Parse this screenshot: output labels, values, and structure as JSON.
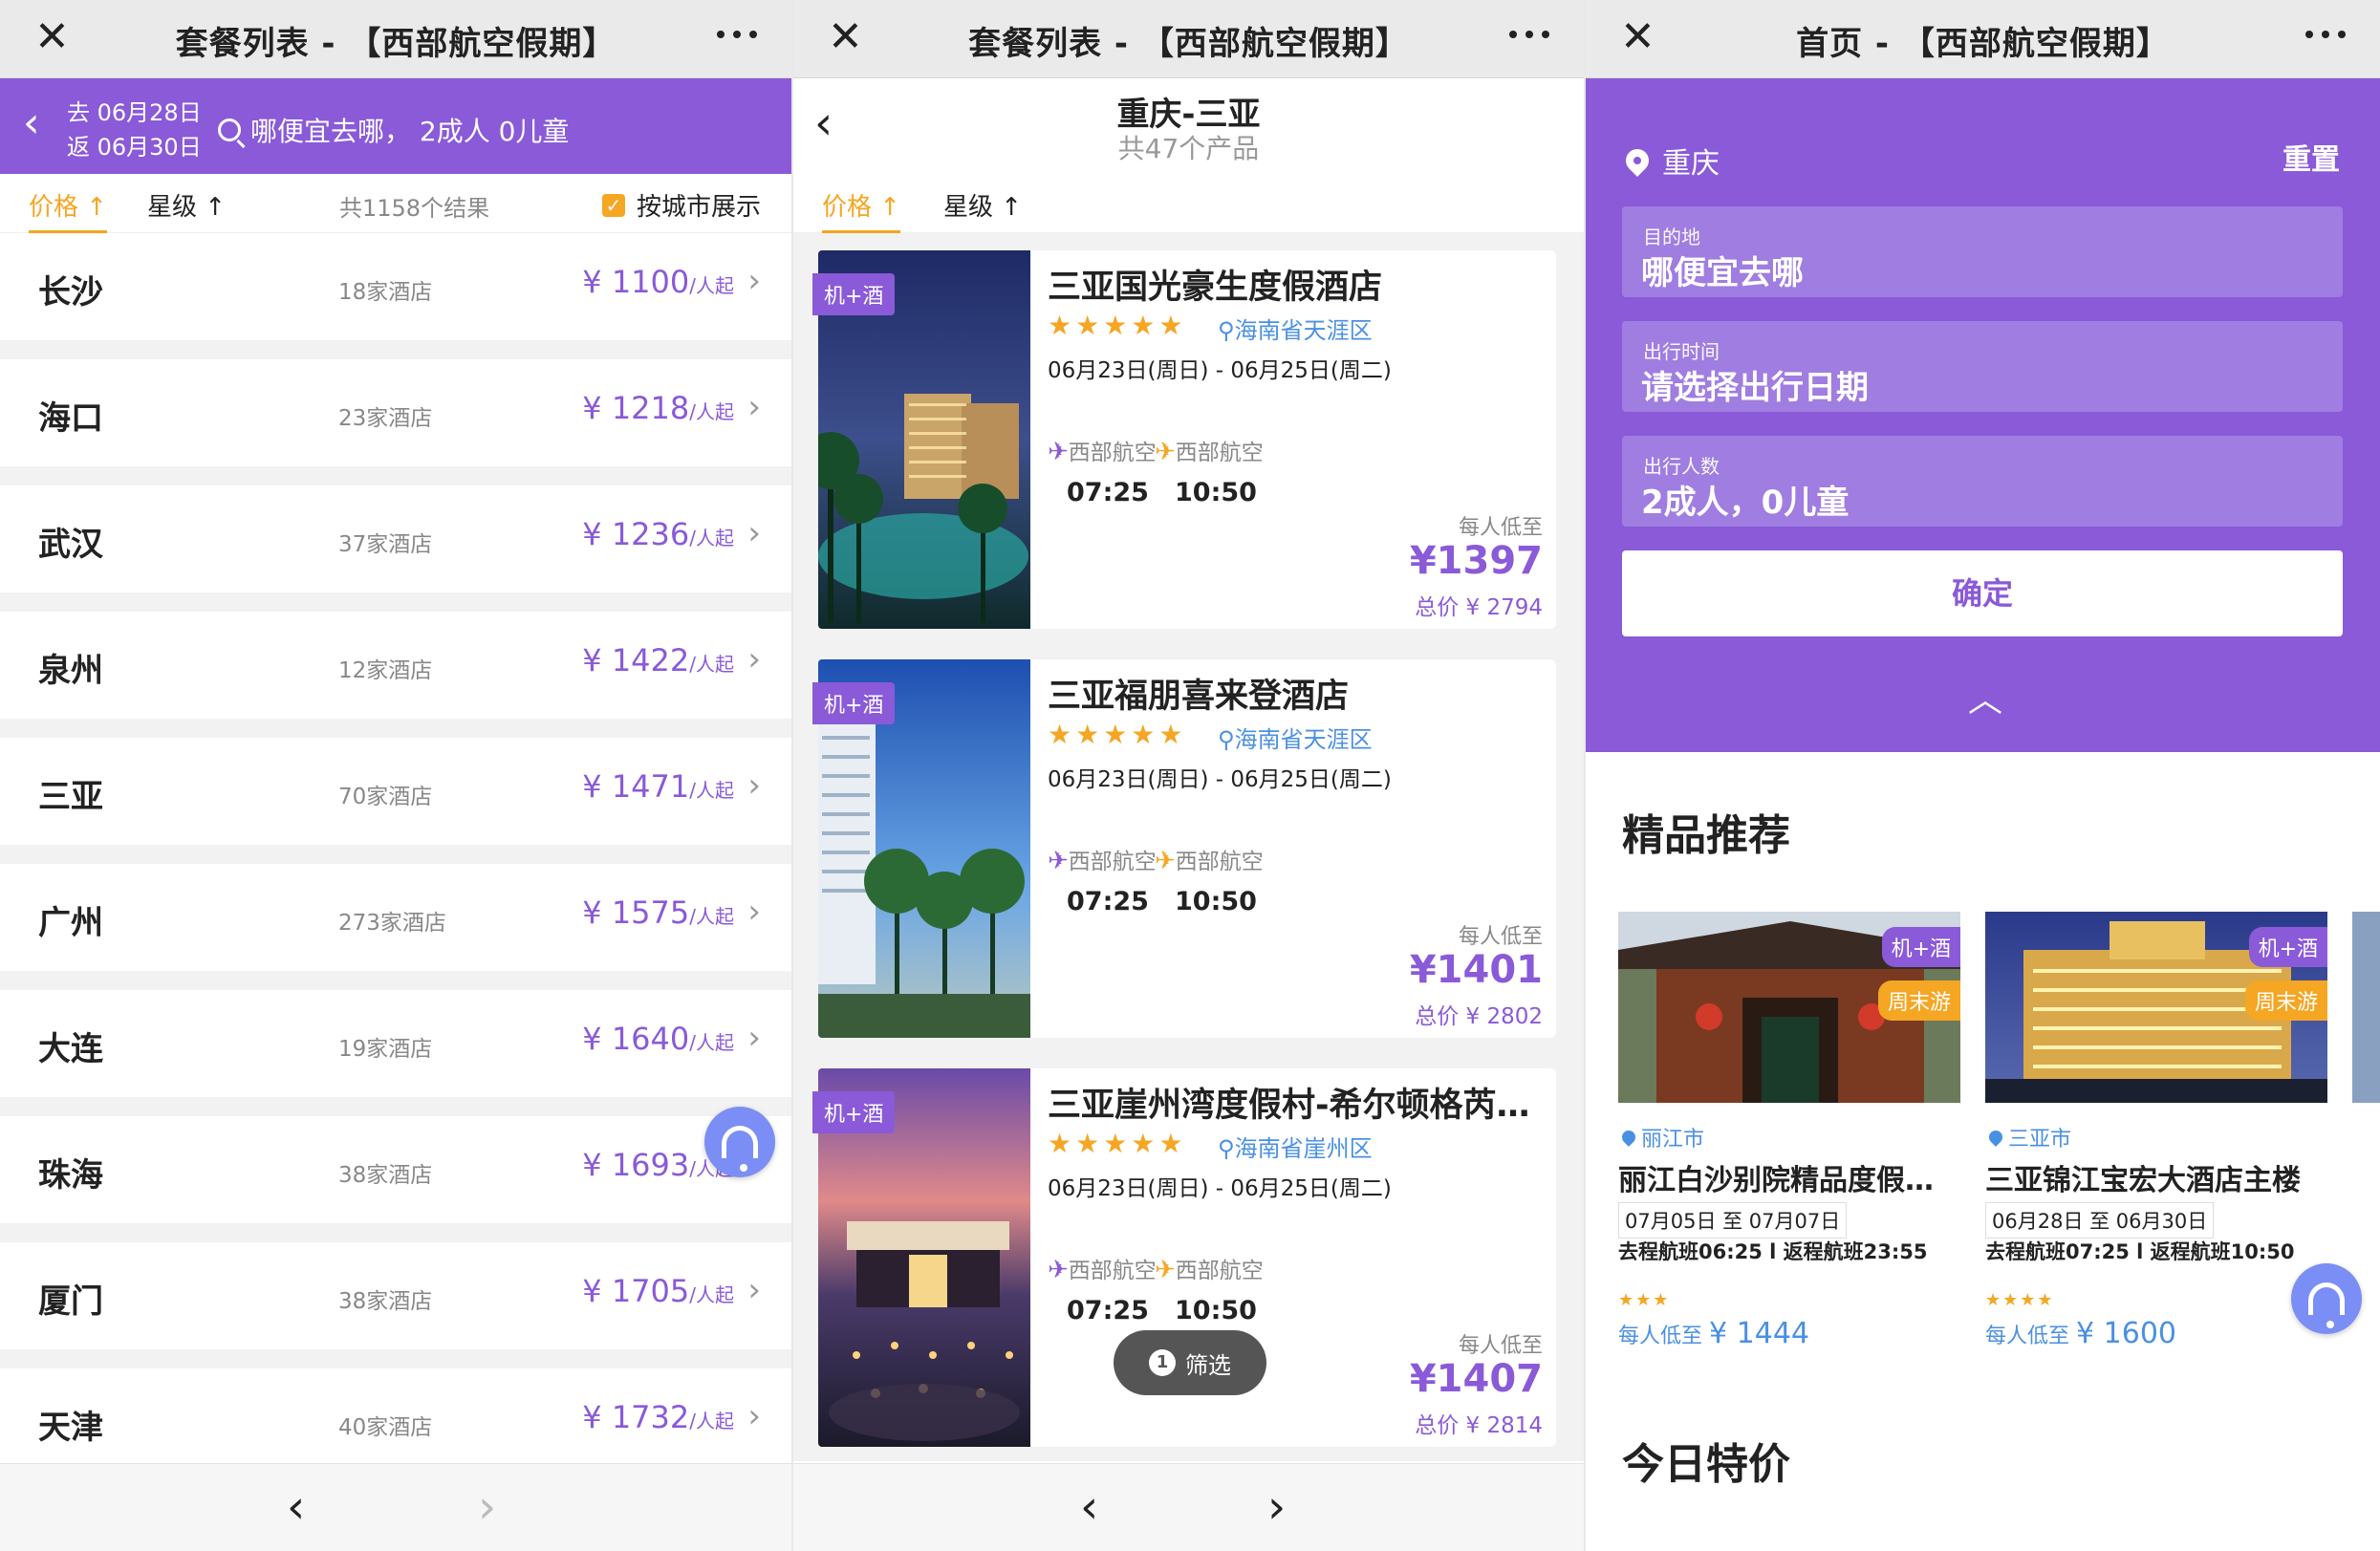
{
  "panel1": {
    "title": "套餐列表 - 【西部航空假期】",
    "back": "‹",
    "depart": "去 06月28日",
    "return": "返 06月30日",
    "search": "哪便宜去哪， 2成人 0儿童",
    "sort_price": "价格 ↑",
    "sort_star": "星级 ↑",
    "count": "共1158个结果",
    "city_toggle": "按城市展示",
    "cities": [
      {
        "name": "长沙",
        "hotels": "18家酒店",
        "price": "¥ 1100",
        "unit": "/人起"
      },
      {
        "name": "海口",
        "hotels": "23家酒店",
        "price": "¥ 1218",
        "unit": "/人起"
      },
      {
        "name": "武汉",
        "hotels": "37家酒店",
        "price": "¥ 1236",
        "unit": "/人起"
      },
      {
        "name": "泉州",
        "hotels": "12家酒店",
        "price": "¥ 1422",
        "unit": "/人起"
      },
      {
        "name": "三亚",
        "hotels": "70家酒店",
        "price": "¥ 1471",
        "unit": "/人起"
      },
      {
        "name": "广州",
        "hotels": "273家酒店",
        "price": "¥ 1575",
        "unit": "/人起"
      },
      {
        "name": "大连",
        "hotels": "19家酒店",
        "price": "¥ 1640",
        "unit": "/人起"
      },
      {
        "name": "珠海",
        "hotels": "38家酒店",
        "price": "¥ 1693",
        "unit": "/人起"
      },
      {
        "name": "厦门",
        "hotels": "38家酒店",
        "price": "¥ 1705",
        "unit": "/人起"
      },
      {
        "name": "天津",
        "hotels": "40家酒店",
        "price": "¥ 1732",
        "unit": "/人起"
      }
    ]
  },
  "panel2": {
    "title": "套餐列表 - 【西部航空假期】",
    "route": "重庆-三亚",
    "route_count": "共47个产品",
    "sort_price": "价格 ↑",
    "sort_star": "星级 ↑",
    "filter": "筛选",
    "filter_count": "1",
    "products": [
      {
        "tag": "机+酒",
        "name": "三亚国光豪生度假酒店",
        "stars": "★★★★★",
        "loc": "海南省天涯区",
        "dates": "06月23日(周日) - 06月25日(周二)",
        "airline_out": "西部航空",
        "airline_back": "西部航空",
        "time_out": "07:25",
        "time_back": "10:50",
        "label": "每人低至",
        "price": "¥1397",
        "total": "总价 ¥ 2794"
      },
      {
        "tag": "机+酒",
        "name": "三亚福朋喜来登酒店",
        "stars": "★★★★★",
        "loc": "海南省天涯区",
        "dates": "06月23日(周日) - 06月25日(周二)",
        "airline_out": "西部航空",
        "airline_back": "西部航空",
        "time_out": "07:25",
        "time_back": "10:50",
        "label": "每人低至",
        "price": "¥1401",
        "total": "总价 ¥ 2802"
      },
      {
        "tag": "机+酒",
        "name": "三亚崖州湾度假村-希尔顿格芮…",
        "stars": "★★★★★",
        "loc": "海南省崖州区",
        "dates": "06月23日(周日) - 06月25日(周二)",
        "airline_out": "西部航空",
        "airline_back": "西部航空",
        "time_out": "07:25",
        "time_back": "10:50",
        "label": "每人低至",
        "price": "¥1407",
        "total": "总价 ¥ 2814"
      }
    ]
  },
  "panel3": {
    "title": "首页 - 【西部航空假期】",
    "city": "重庆",
    "reset": "重置",
    "dest_label": "目的地",
    "dest_value": "哪便宜去哪",
    "time_label": "出行时间",
    "time_value": "请选择出行日期",
    "people_label": "出行人数",
    "people_value": "2成人，0儿童",
    "confirm": "确定",
    "section1": "精品推荐",
    "section2": "今日特价",
    "recs": [
      {
        "b1": "机+酒",
        "b2": "周末游",
        "city": "丽江市",
        "name": "丽江白沙别院精品度假…",
        "dates": "07月05日 至 07月07日",
        "flights": "去程航班06:25 l 返程航班23:55",
        "stars": "★★★",
        "label": "每人低至",
        "price": "¥ 1444"
      },
      {
        "b1": "机+酒",
        "b2": "周末游",
        "city": "三亚市",
        "name": "三亚锦江宝宏大酒店主楼",
        "dates": "06月28日 至 06月30日",
        "flights": "去程航班07:25 l 返程航班10:50",
        "stars": "★★★★",
        "label": "每人低至",
        "price": "¥ 1600"
      }
    ]
  },
  "colors": {
    "primary": "#8a5ad8",
    "accent": "#f5a623",
    "link": "#4a90e2"
  }
}
